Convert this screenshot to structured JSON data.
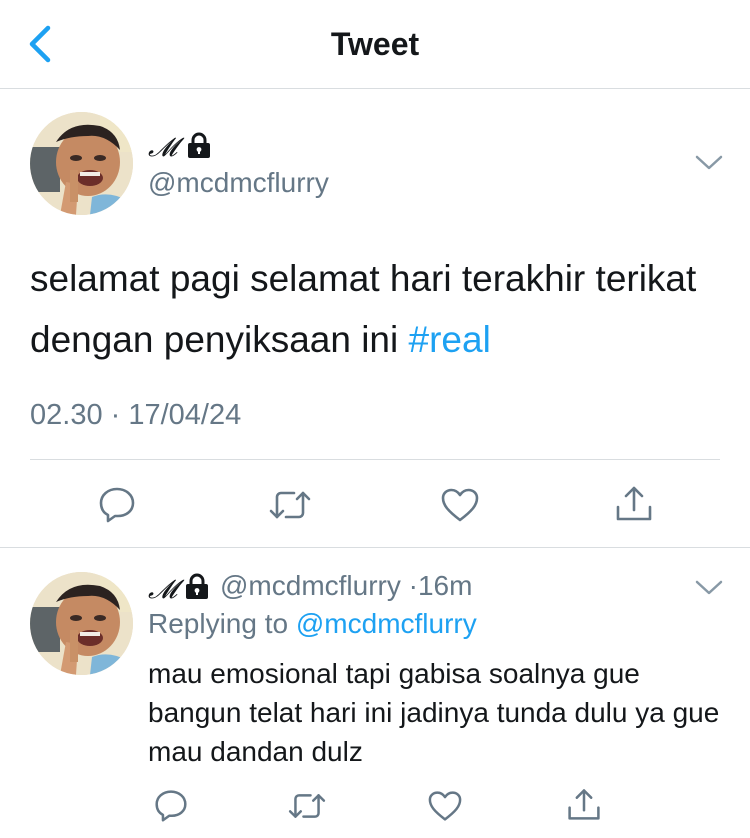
{
  "header": {
    "title": "Tweet",
    "back_icon": "chevron-left-icon"
  },
  "tweet": {
    "display_name": "𝓜",
    "handle": "@mcdmcflurry",
    "text": "selamat pagi selamat hari terakhir terikat dengan penyiksaan ini ",
    "hashtag": "#real",
    "timestamp": "02.30 · 17/04/24",
    "protected_icon": "lock-icon",
    "actions": [
      "comment-icon",
      "retweet-icon",
      "like-icon",
      "share-icon"
    ]
  },
  "reply": {
    "display_name": "𝓜",
    "handle": "@mcdmcflurry",
    "separator": "·",
    "time_ago": "16m",
    "replying_prefix": "Replying to ",
    "replying_to": "@mcdmcflurry",
    "text": "mau emosional tapi gabisa soalnya gue bangun telat hari ini jadinya tunda dulu ya gue mau dandan dulz",
    "actions": [
      "comment-icon",
      "retweet-icon",
      "like-icon",
      "share-icon"
    ]
  },
  "colors": {
    "accent": "#1da1f2",
    "secondary_text": "#657786",
    "primary_text": "#14171a",
    "divider": "#d9dde0",
    "icon": "#657786"
  }
}
